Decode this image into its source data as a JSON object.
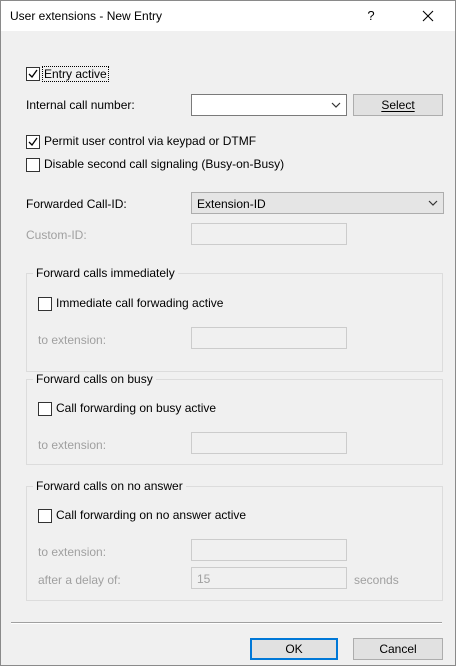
{
  "window": {
    "title": "User extensions - New Entry",
    "help_glyph": "?",
    "close_icon": "close-icon"
  },
  "form": {
    "entry_active": {
      "label": "Entry active",
      "checked": true
    },
    "internal_call_number": {
      "label": "Internal call number:",
      "value": "",
      "select_label": "Select"
    },
    "permit_user_control": {
      "label": "Permit user control via keypad or DTMF",
      "checked": true
    },
    "disable_second_call": {
      "label": "Disable second call signaling (Busy-on-Busy)",
      "checked": false
    },
    "forwarded_call_id": {
      "label": "Forwarded Call-ID:",
      "value": "Extension-ID"
    },
    "custom_id": {
      "label": "Custom-ID:",
      "value": ""
    }
  },
  "groups": {
    "immediately": {
      "title": "Forward calls immediately",
      "checkbox_label": "Immediate call forwading active",
      "checked": false,
      "ext_label": "to extension:",
      "ext_value": ""
    },
    "busy": {
      "title": "Forward calls on busy",
      "checkbox_label": "Call forwarding on busy active",
      "checked": false,
      "ext_label": "to extension:",
      "ext_value": ""
    },
    "no_answer": {
      "title": "Forward calls on no answer",
      "checkbox_label": "Call forwarding on no answer active",
      "checked": false,
      "ext_label": "to extension:",
      "ext_value": "",
      "delay_label": "after a delay of:",
      "delay_value": "15",
      "delay_unit": "seconds"
    }
  },
  "buttons": {
    "ok": "OK",
    "cancel": "Cancel"
  }
}
